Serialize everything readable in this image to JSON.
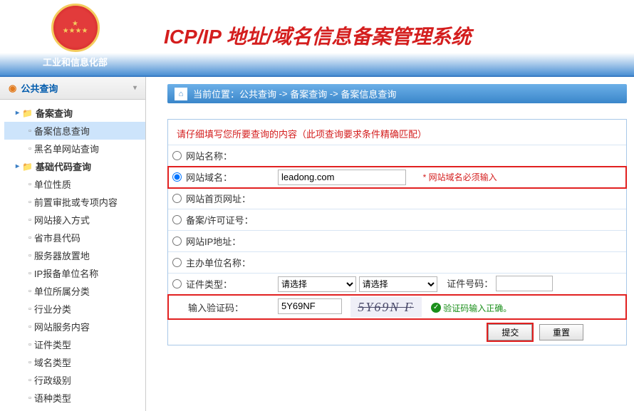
{
  "ministry": "工业和信息化部",
  "system_title": "ICP/IP 地址/域名信息备案管理系统",
  "sidebar": {
    "header": "公共查询",
    "groups": [
      {
        "label": "备案查询",
        "items": [
          {
            "label": "备案信息查询",
            "active": true
          },
          {
            "label": "黑名单网站查询",
            "active": false
          }
        ]
      },
      {
        "label": "基础代码查询",
        "items": [
          {
            "label": "单位性质"
          },
          {
            "label": "前置审批或专项内容"
          },
          {
            "label": "网站接入方式"
          },
          {
            "label": "省市县代码"
          },
          {
            "label": "服务器放置地"
          },
          {
            "label": "IP报备单位名称"
          },
          {
            "label": "单位所属分类"
          },
          {
            "label": "行业分类"
          },
          {
            "label": "网站服务内容"
          },
          {
            "label": "证件类型"
          },
          {
            "label": "域名类型"
          },
          {
            "label": "行政级别"
          },
          {
            "label": "语种类型"
          }
        ]
      }
    ]
  },
  "breadcrumb": {
    "prefix": "当前位置：",
    "parts": [
      "公共查询",
      "备案查询",
      "备案信息查询"
    ],
    "sep": "->"
  },
  "form": {
    "instruction": "请仔细填写您所要查询的内容（此项查询要求条件精确匹配）",
    "rows": {
      "site_name": "网站名称：",
      "site_domain": "网站域名：",
      "home_url": "网站首页网址：",
      "license_no": "备案/许可证号：",
      "ip": "网站IP地址：",
      "host_unit": "主办单位名称：",
      "cert_type": "证件类型：",
      "cert_no_label": "证件号码：",
      "captcha": "输入验证码："
    },
    "domain_value": "leadong.com",
    "required_note": "* 网站域名必须输入",
    "select_placeholder": "请选择",
    "captcha_value": "5Y69NF",
    "captcha_image": "5Y69N F",
    "captcha_ok": "验证码输入正确。",
    "submit": "提交",
    "reset": "重置"
  }
}
